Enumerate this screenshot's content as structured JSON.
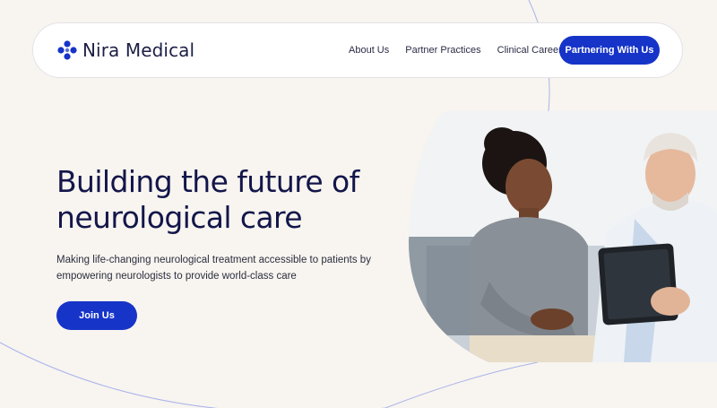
{
  "brand": {
    "name": "Nira Medical",
    "logo_icon": "plus-cross-logo-icon"
  },
  "nav": {
    "links": [
      "About Us",
      "Partner Practices",
      "Clinical Careers"
    ],
    "cta_label": "Partnering With Us"
  },
  "hero": {
    "title_line1": "Building the future of",
    "title_line2": "neurological care",
    "subtitle_line1": "Making life-changing neurological treatment accessible to patients by",
    "subtitle_line2": "empowering neurologists to provide world-class care",
    "cta_label": "Join Us",
    "image_icon": "patient-doctor-photo"
  },
  "colors": {
    "background": "#f8f4ef",
    "accent": "#1634c8",
    "heading": "#12164a",
    "arc_line": "#a9b4ec"
  }
}
